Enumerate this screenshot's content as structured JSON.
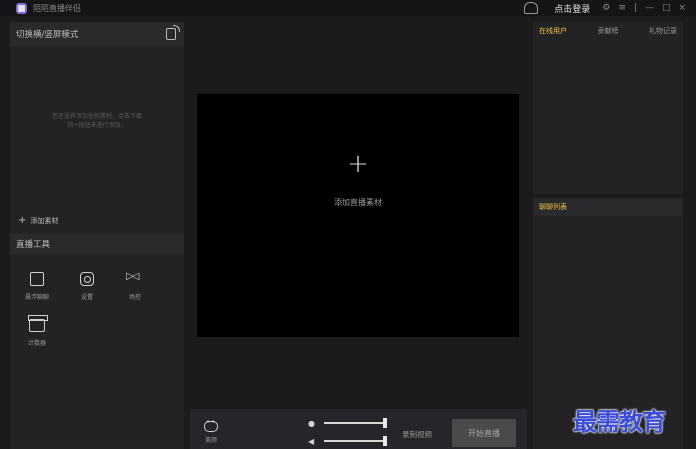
{
  "app": {
    "title": "陌陌直播伴侣"
  },
  "titlebar": {
    "login_label": "点击登录",
    "settings_symbol": "⚙",
    "menu_symbol": "≡",
    "separator": "|",
    "minimize_symbol": "—",
    "maximize_symbol": "□",
    "close_symbol": "×"
  },
  "left_panel": {
    "mode_toggle_label": "切换横/竖屏模式",
    "empty_hint": "您还没有添加任何素材，点击下面的+按钮来进行添加。",
    "add_material_label": "添加素材"
  },
  "tools": {
    "section_title": "直播工具",
    "items": [
      {
        "label": "悬浮聊聊",
        "icon": "chat-float-icon"
      },
      {
        "label": "设置",
        "icon": "settings-icon"
      },
      {
        "label": "场控",
        "icon": "scene-control-icon"
      },
      {
        "label": "计数器",
        "icon": "gift-counter-icon"
      }
    ]
  },
  "preview": {
    "plus_symbol": "+",
    "add_label": "添加直播素材"
  },
  "bottom_bar": {
    "beauty_label": "美颜",
    "record_label": "录制视频",
    "start_label": "开始直播",
    "mic_volume": 1.0,
    "speaker_volume": 1.0
  },
  "right_panel": {
    "tabs": [
      {
        "label": "在线用户",
        "active": true
      },
      {
        "label": "贡献榜",
        "active": false
      },
      {
        "label": "礼物记录",
        "active": false
      }
    ],
    "chat_list_title": "聊聊列表"
  },
  "watermark": {
    "text": "最需教育"
  },
  "colors": {
    "accent": "#f0c340",
    "background": "#1b1b1d",
    "panel": "#232325",
    "watermark": "#3a4bd6"
  }
}
